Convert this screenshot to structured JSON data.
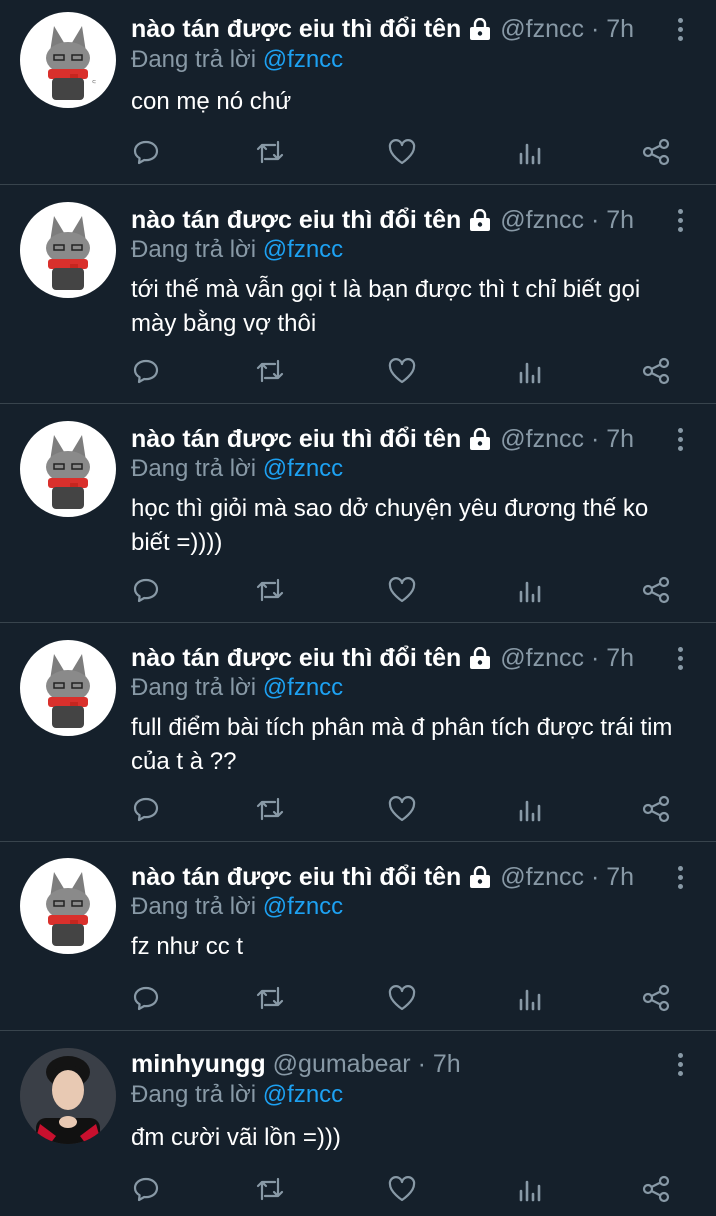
{
  "icons": {
    "more": "more-vertical-icon",
    "lock": "lock-icon",
    "reply": "reply-icon",
    "retweet": "retweet-icon",
    "like": "heart-icon",
    "analytics": "analytics-icon",
    "share": "share-icon"
  },
  "colors": {
    "background": "#15202b",
    "divider": "#38444d",
    "secondary_text": "#8899a6",
    "accent": "#1da1f2"
  },
  "tweets": [
    {
      "name": "nào tán được eiu thì đổi tên",
      "locked": true,
      "handle": "@fzncc",
      "separator": "·",
      "time": "7h",
      "replying_prefix": "Đang trả lời",
      "replying_to": "@fzncc",
      "text": "con mẹ nó chứ",
      "avatar": "cat-avatar"
    },
    {
      "name": "nào tán được eiu thì đổi tên",
      "locked": true,
      "handle": "@fzncc",
      "separator": "·",
      "time": "7h",
      "replying_prefix": "Đang trả lời",
      "replying_to": "@fzncc",
      "text": "tới thế mà vẫn gọi t là bạn được thì t chỉ biết gọi mày bằng vợ thôi",
      "avatar": "cat-avatar"
    },
    {
      "name": "nào tán được eiu thì đổi tên",
      "locked": true,
      "handle": "@fzncc",
      "separator": "·",
      "time": "7h",
      "replying_prefix": "Đang trả lời",
      "replying_to": "@fzncc",
      "text": "học thì giỏi mà sao dở chuyện yêu đương thế ko biết =))))",
      "avatar": "cat-avatar"
    },
    {
      "name": "nào tán được eiu thì đổi tên",
      "locked": true,
      "handle": "@fzncc",
      "separator": "·",
      "time": "7h",
      "replying_prefix": "Đang trả lời",
      "replying_to": "@fzncc",
      "text": "full điểm bài tích phân mà đ phân tích được trái tim của t à ??",
      "avatar": "cat-avatar"
    },
    {
      "name": "nào tán được eiu thì đổi tên",
      "locked": true,
      "handle": "@fzncc",
      "separator": "·",
      "time": "7h",
      "replying_prefix": "Đang trả lời",
      "replying_to": "@fzncc",
      "text": "fz như cc t",
      "avatar": "cat-avatar"
    },
    {
      "name": "minhyungg",
      "locked": false,
      "handle": "@gumabear",
      "separator": "·",
      "time": "7h",
      "replying_prefix": "Đang trả lời",
      "replying_to": "@fzncc",
      "text": "đm cười vãi lồn =)))",
      "avatar": "person-avatar"
    }
  ]
}
